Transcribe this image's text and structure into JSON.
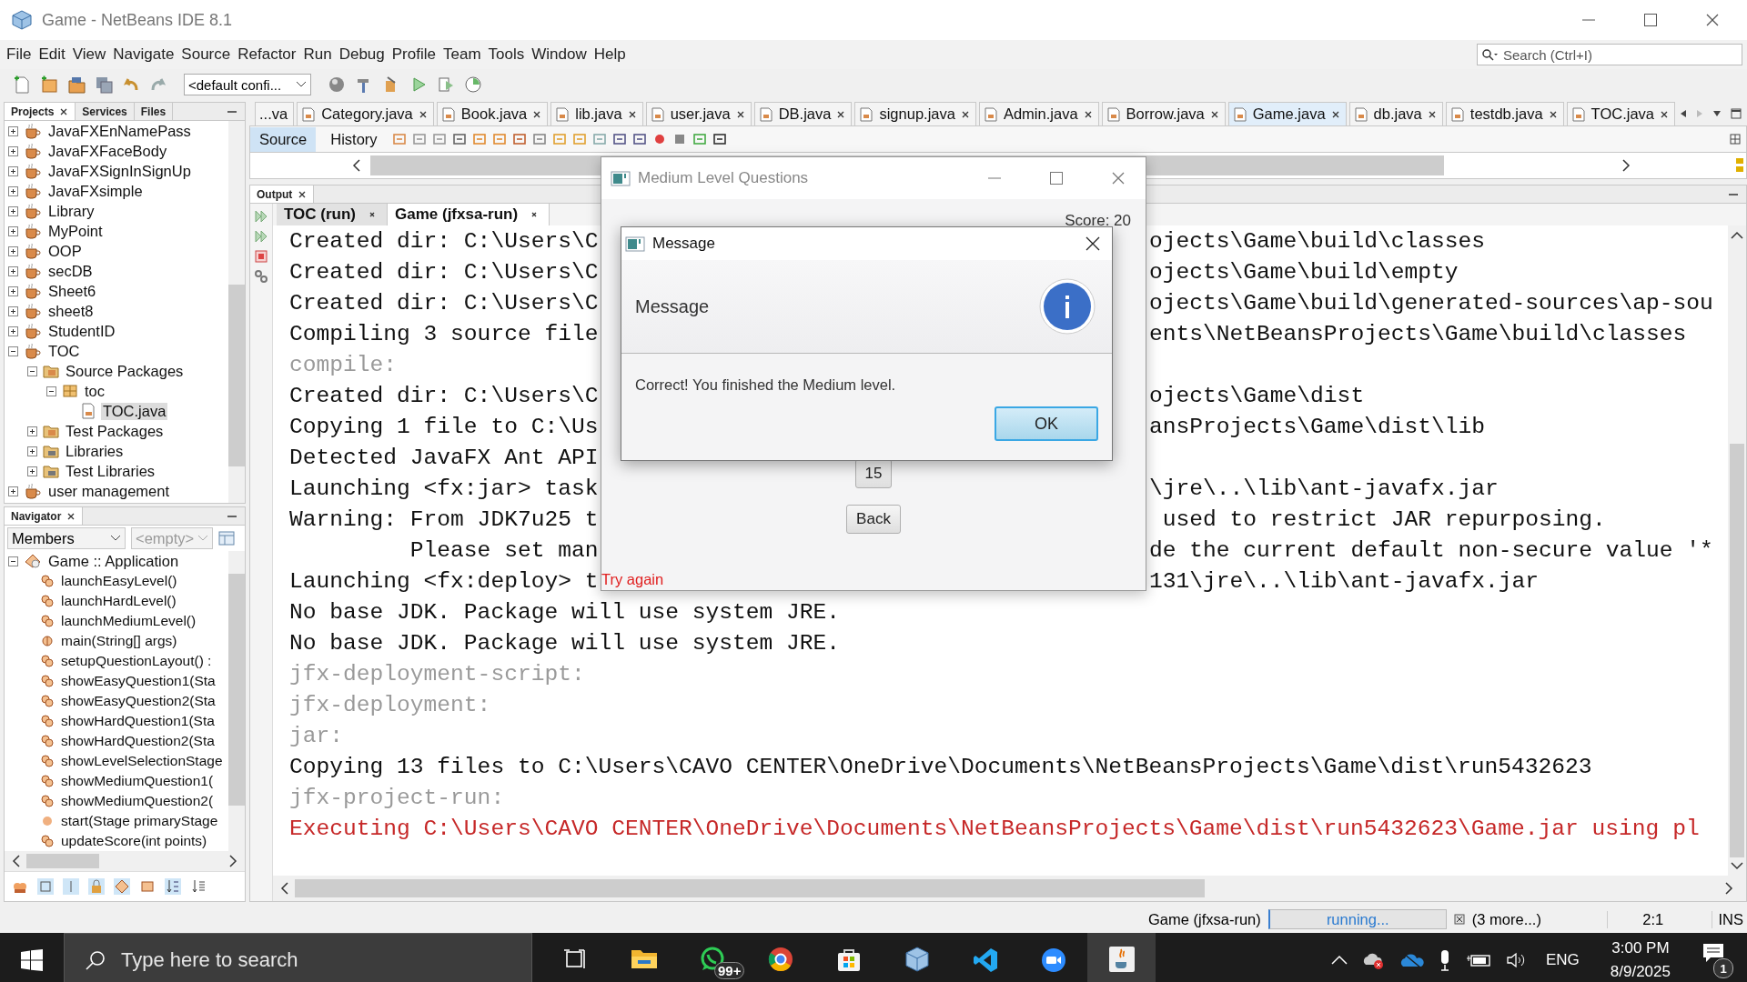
{
  "window": {
    "title": "Game - NetBeans IDE 8.1"
  },
  "menu": [
    "File",
    "Edit",
    "View",
    "Navigate",
    "Source",
    "Refactor",
    "Run",
    "Debug",
    "Profile",
    "Team",
    "Tools",
    "Window",
    "Help"
  ],
  "search": {
    "placeholder": "Search (Ctrl+I)"
  },
  "toolbar": {
    "configuration": "<default confi..."
  },
  "projects_panel": {
    "tabs": [
      {
        "label": "Projects",
        "selected": true
      },
      {
        "label": "Services",
        "selected": false
      },
      {
        "label": "Files",
        "selected": false
      }
    ],
    "tree": [
      {
        "label": "JavaFXEnNamePass",
        "kind": "project",
        "expanded": false,
        "selected": false
      },
      {
        "label": "JavaFXFaceBody",
        "kind": "project",
        "expanded": false,
        "selected": false
      },
      {
        "label": "JavaFXSignInSignUp",
        "kind": "project",
        "expanded": false,
        "selected": false
      },
      {
        "label": "JavaFXsimple",
        "kind": "project",
        "expanded": false,
        "selected": false
      },
      {
        "label": "Library",
        "kind": "project",
        "expanded": false,
        "selected": false
      },
      {
        "label": "MyPoint",
        "kind": "project",
        "expanded": false,
        "selected": false
      },
      {
        "label": "OOP",
        "kind": "project",
        "expanded": false,
        "selected": false
      },
      {
        "label": "secDB",
        "kind": "project",
        "expanded": false,
        "selected": false
      },
      {
        "label": "Sheet6",
        "kind": "project",
        "expanded": false,
        "selected": false
      },
      {
        "label": "sheet8",
        "kind": "project",
        "expanded": false,
        "selected": false
      },
      {
        "label": "StudentID",
        "kind": "project",
        "expanded": false,
        "selected": false
      },
      {
        "label": "TOC",
        "kind": "project",
        "expanded": true,
        "selected": false,
        "children": [
          {
            "label": "Source Packages",
            "kind": "source-folder",
            "expanded": true,
            "selected": false,
            "children": [
              {
                "label": "toc",
                "kind": "package",
                "expanded": true,
                "selected": false,
                "children": [
                  {
                    "label": "TOC.java",
                    "kind": "file",
                    "selected": true
                  }
                ]
              }
            ]
          },
          {
            "label": "Test Packages",
            "kind": "source-folder",
            "expanded": false,
            "selected": false
          },
          {
            "label": "Libraries",
            "kind": "library-folder",
            "expanded": false,
            "selected": false
          },
          {
            "label": "Test Libraries",
            "kind": "library-folder",
            "expanded": false,
            "selected": false
          }
        ]
      },
      {
        "label": "user management",
        "kind": "project",
        "expanded": false,
        "selected": false
      }
    ]
  },
  "navigator": {
    "title": "Navigator",
    "filter": "Members",
    "second_filter": "<empty>",
    "tree": [
      {
        "label": "Game :: Application",
        "expanded": true,
        "children": [
          {
            "label": "launchEasyLevel()",
            "kind": "method"
          },
          {
            "label": "launchHardLevel()",
            "kind": "method"
          },
          {
            "label": "launchMediumLevel()",
            "kind": "method"
          },
          {
            "label": "main(String[] args)",
            "kind": "static-method"
          },
          {
            "label": "setupQuestionLayout() :",
            "kind": "method"
          },
          {
            "label": "showEasyQuestion1(Sta",
            "kind": "method"
          },
          {
            "label": "showEasyQuestion2(Sta",
            "kind": "method"
          },
          {
            "label": "showHardQuestion1(Sta",
            "kind": "method"
          },
          {
            "label": "showHardQuestion2(Sta",
            "kind": "method"
          },
          {
            "label": "showLevelSelectionStage",
            "kind": "method"
          },
          {
            "label": "showMediumQuestion1(",
            "kind": "method"
          },
          {
            "label": "showMediumQuestion2(",
            "kind": "method"
          },
          {
            "label": "start(Stage primaryStage",
            "kind": "override-method"
          },
          {
            "label": "updateScore(int points)",
            "kind": "method"
          }
        ]
      }
    ]
  },
  "editor_tabs": [
    {
      "label": "...va",
      "selected": false,
      "closable": false
    },
    {
      "label": "Category.java",
      "selected": false,
      "closable": true
    },
    {
      "label": "Book.java",
      "selected": false,
      "closable": true
    },
    {
      "label": "lib.java",
      "selected": false,
      "closable": true
    },
    {
      "label": "user.java",
      "selected": false,
      "closable": true
    },
    {
      "label": "DB.java",
      "selected": false,
      "closable": true
    },
    {
      "label": "signup.java",
      "selected": false,
      "closable": true
    },
    {
      "label": "Admin.java",
      "selected": false,
      "closable": true
    },
    {
      "label": "Borrow.java",
      "selected": false,
      "closable": true
    },
    {
      "label": "Game.java",
      "selected": true,
      "closable": true
    },
    {
      "label": "db.java",
      "selected": false,
      "closable": true
    },
    {
      "label": "testdb.java",
      "selected": false,
      "closable": true
    },
    {
      "label": "TOC.java",
      "selected": false,
      "closable": true
    }
  ],
  "editor_views": [
    {
      "label": "Source",
      "selected": true
    },
    {
      "label": "History",
      "selected": false
    }
  ],
  "output": {
    "title": "Output",
    "tabs": [
      {
        "label": "TOC (run)",
        "selected": false
      },
      {
        "label": "Game (jfxsa-run)",
        "selected": true
      }
    ],
    "lines": [
      {
        "kind": "normal",
        "text": "Created dir: C:\\Users\\C",
        "text_right": "ojects\\Game\\build\\classes"
      },
      {
        "kind": "normal",
        "text": "Created dir: C:\\Users\\C",
        "text_right": "ojects\\Game\\build\\empty"
      },
      {
        "kind": "normal",
        "text": "Created dir: C:\\Users\\C",
        "text_right": "ojects\\Game\\build\\generated-sources\\ap-sou"
      },
      {
        "kind": "normal",
        "text": "Compiling 3 source file",
        "text_right": "ents\\NetBeansProjects\\Game\\build\\classes"
      },
      {
        "kind": "muted",
        "text": "compile:"
      },
      {
        "kind": "normal",
        "text": "Created dir: C:\\Users\\C",
        "text_right": "ojects\\Game\\dist"
      },
      {
        "kind": "normal",
        "text": "Copying 1 file to C:\\Us",
        "text_right": "ansProjects\\Game\\dist\\lib"
      },
      {
        "kind": "normal",
        "text": "Detected JavaFX Ant API"
      },
      {
        "kind": "normal",
        "text": "Launching <fx:jar> task",
        "text_right": "\\jre\\..\\lib\\ant-javafx.jar"
      },
      {
        "kind": "normal",
        "text": "Warning: From JDK7u25 t",
        "text_right": " used to restrict JAR repurposing."
      },
      {
        "kind": "normal",
        "text": "         Please set man",
        "text_right": "de the current default non-secure value '*"
      },
      {
        "kind": "normal",
        "text": "Launching <fx:deploy> t",
        "text_right": "131\\jre\\..\\lib\\ant-javafx.jar"
      },
      {
        "kind": "normal",
        "text": "No base JDK. Package will use system JRE."
      },
      {
        "kind": "normal",
        "text": "No base JDK. Package will use system JRE."
      },
      {
        "kind": "muted",
        "text": "jfx-deployment-script:"
      },
      {
        "kind": "muted",
        "text": "jfx-deployment:"
      },
      {
        "kind": "muted",
        "text": "jar:"
      },
      {
        "kind": "normal",
        "text": "Copying 13 files to C:\\Users\\CAVO CENTER\\OneDrive\\Documents\\NetBeansProjects\\Game\\dist\\run5432623"
      },
      {
        "kind": "muted",
        "text": "jfx-project-run:"
      },
      {
        "kind": "error",
        "text": "Executing C:\\Users\\CAVO CENTER\\OneDrive\\Documents\\NetBeansProjects\\Game\\dist\\run5432623\\Game.jar using pl"
      }
    ]
  },
  "app_window": {
    "title": "Medium Level Questions",
    "score": "Score: 20",
    "answer_button": "15",
    "back_button": "Back",
    "feedback": "Try again"
  },
  "message_dialog": {
    "title": "Message",
    "header": "Message",
    "content": "Correct! You finished the Medium level.",
    "button": "OK"
  },
  "status_bar": {
    "task": "Game (jfxsa-run)",
    "progress": "running...",
    "more": "(3 more...)",
    "position": "2:1",
    "mode": "INS"
  },
  "taskbar": {
    "search_placeholder": "Type here to search",
    "apps": [
      {
        "kind": "task-view",
        "running": false,
        "active": false
      },
      {
        "kind": "file-explorer",
        "running": true,
        "active": false
      },
      {
        "kind": "whatsapp",
        "running": true,
        "active": false,
        "badge": "99+"
      },
      {
        "kind": "chrome",
        "running": true,
        "active": false
      },
      {
        "kind": "store",
        "running": true,
        "active": false
      },
      {
        "kind": "cube",
        "running": true,
        "active": false
      },
      {
        "kind": "vscode",
        "running": false,
        "active": false
      },
      {
        "kind": "zoom",
        "running": false,
        "active": false
      },
      {
        "kind": "java",
        "running": true,
        "active": true
      }
    ],
    "tray": {
      "language": "ENG",
      "time": "3:00 PM",
      "date": "8/9/2025",
      "notifications": "1"
    }
  }
}
